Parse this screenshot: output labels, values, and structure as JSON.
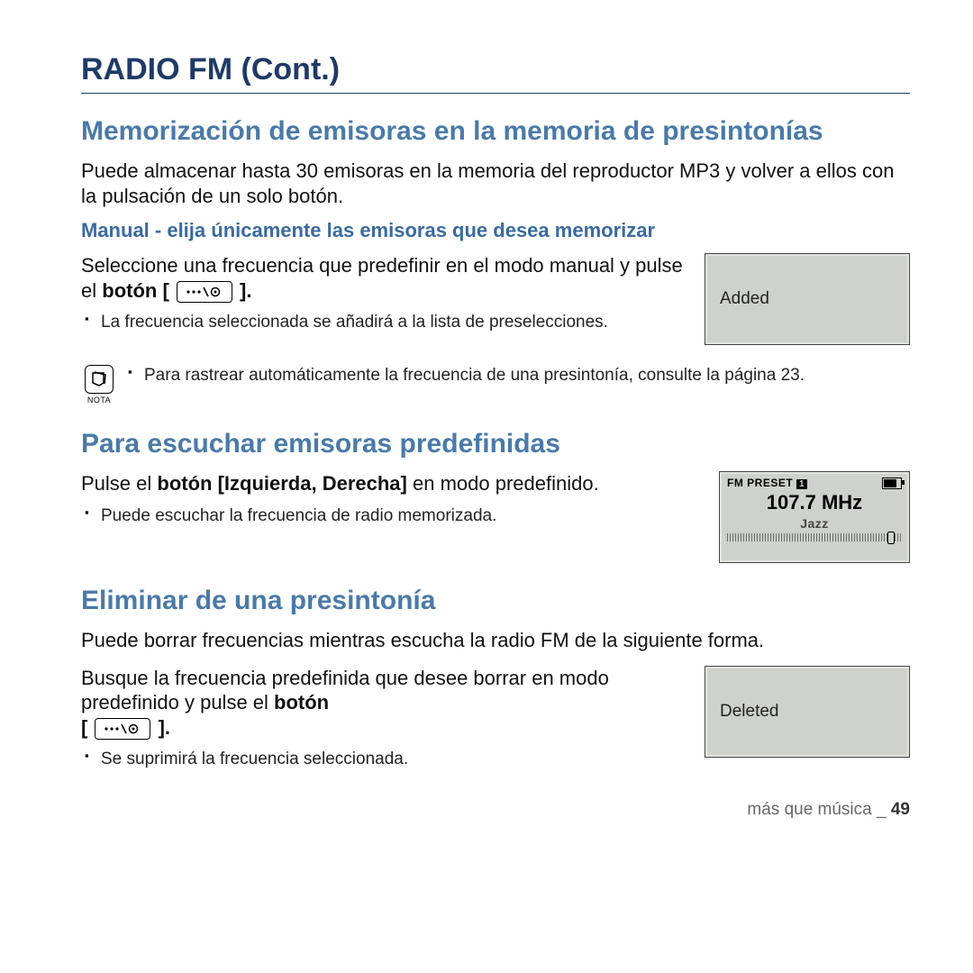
{
  "title": "RADIO FM (Cont.)",
  "section1": {
    "title": "Memorización de emisoras en la memoria de presintonías",
    "intro": "Puede almacenar hasta 30 emisoras en la memoria del reproductor MP3 y volver a ellos con la pulsación de un solo botón.",
    "manual_sub": "Manual - elija únicamente las emisoras que desea memorizar",
    "instr_a": "Seleccione una frecuencia que predefinir en el modo manual y pulse el ",
    "instr_b_bold": "botón [",
    "instr_c": " ].",
    "bullet": "La frecuencia seleccionada se añadirá a la lista de preselecciones.",
    "screen": "Added",
    "note_label": "NOTA",
    "note_text": "Para rastrear automáticamente la frecuencia de una presintonía, consulte la página 23."
  },
  "section2": {
    "title": "Para escuchar emisoras predefinidas",
    "instr_a": "Pulse el ",
    "instr_bold": "botón [Izquierda, Derecha]",
    "instr_b": " en modo predefinido.",
    "bullet": "Puede escuchar la frecuencia de radio memorizada.",
    "screen": {
      "top_left": "FM PRESET",
      "preset_num": "1",
      "freq": "107.7 MHz",
      "genre": "Jazz"
    }
  },
  "section3": {
    "title": "Eliminar de una presintonía",
    "intro": "Puede borrar frecuencias mientras escucha la radio FM de la siguiente forma.",
    "instr_a": "Busque la frecuencia predefinida que desee borrar en modo predefinido y pulse el ",
    "instr_bold": "botón",
    "instr_b_open": "[",
    "instr_b_close": " ].",
    "bullet": "Se suprimirá la frecuencia seleccionada.",
    "screen": "Deleted"
  },
  "footer": {
    "text": "más que música _ ",
    "page": "49"
  }
}
